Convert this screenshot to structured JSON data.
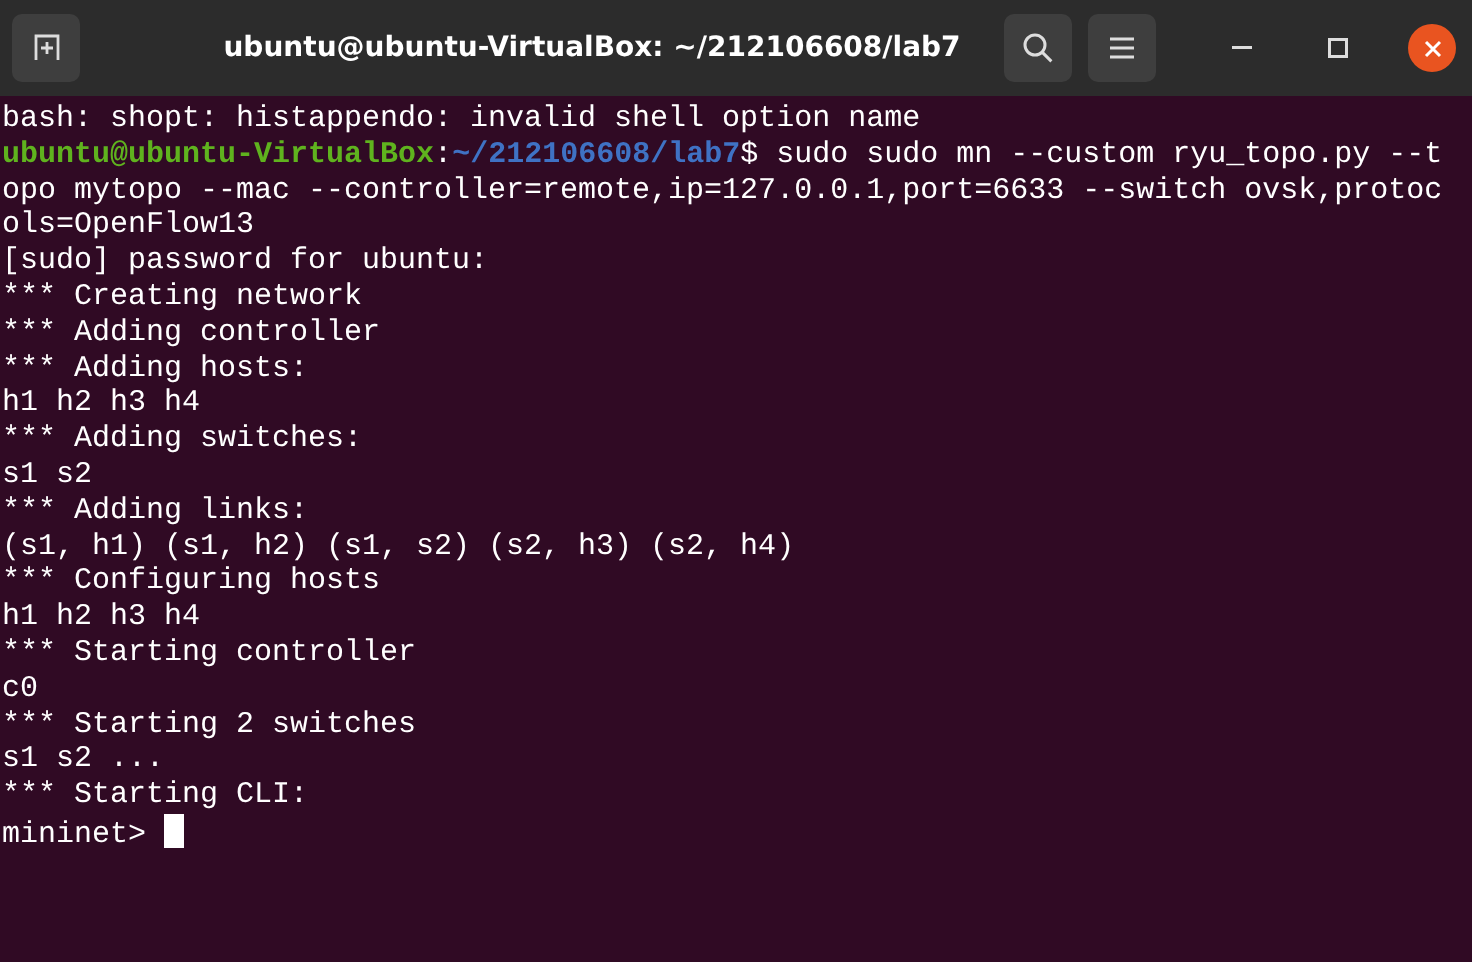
{
  "window": {
    "title": "ubuntu@ubuntu-VirtualBox: ~/212106608/lab7"
  },
  "terminal": {
    "lines": [
      {
        "kind": "output",
        "text": "bash: shopt: histappendo: invalid shell option name"
      },
      {
        "kind": "prompt",
        "user_host": "ubuntu@ubuntu-VirtualBox",
        "separator": ":",
        "path": "~/212106608/lab7",
        "symbol": "$",
        "command": "sudo sudo mn --custom ryu_topo.py --t"
      },
      {
        "kind": "output",
        "text": "opo mytopo --mac --controller=remote,ip=127.0.0.1,port=6633 --switch ovsk,protoc"
      },
      {
        "kind": "output",
        "text": "ols=OpenFlow13"
      },
      {
        "kind": "output",
        "text": "[sudo] password for ubuntu:"
      },
      {
        "kind": "output",
        "text": "*** Creating network"
      },
      {
        "kind": "output",
        "text": "*** Adding controller"
      },
      {
        "kind": "output",
        "text": "*** Adding hosts:"
      },
      {
        "kind": "output",
        "text": "h1 h2 h3 h4"
      },
      {
        "kind": "output",
        "text": "*** Adding switches:"
      },
      {
        "kind": "output",
        "text": "s1 s2"
      },
      {
        "kind": "output",
        "text": "*** Adding links:"
      },
      {
        "kind": "output",
        "text": "(s1, h1) (s1, h2) (s1, s2) (s2, h3) (s2, h4)"
      },
      {
        "kind": "output",
        "text": "*** Configuring hosts"
      },
      {
        "kind": "output",
        "text": "h1 h2 h3 h4"
      },
      {
        "kind": "output",
        "text": "*** Starting controller"
      },
      {
        "kind": "output",
        "text": "c0"
      },
      {
        "kind": "output",
        "text": "*** Starting 2 switches"
      },
      {
        "kind": "output",
        "text": "s1 s2 ..."
      },
      {
        "kind": "output",
        "text": "*** Starting CLI:"
      },
      {
        "kind": "input",
        "text": "mininet>",
        "cursor": true
      }
    ]
  }
}
